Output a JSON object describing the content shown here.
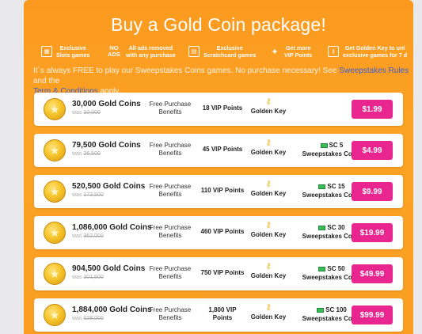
{
  "title": "Buy a Gold Coin package!",
  "features": [
    {
      "icon": "slots-icon",
      "glyph": "▦",
      "text1": "Exclusive",
      "text2": "Slots games"
    },
    {
      "icon": "no-ads-icon",
      "glyph": "NO ADS",
      "text1": "All ads removed",
      "text2": "with any purchase"
    },
    {
      "icon": "scratchcard-icon",
      "glyph": "▤",
      "text1": "Exclusive",
      "text2": "Scratchcard games"
    },
    {
      "icon": "sparkle-icon",
      "glyph": "✦",
      "text1": "Get more",
      "text2": "VIP Points"
    },
    {
      "icon": "key-icon",
      "glyph": "⚷",
      "text1": "Get Golden Key to unl",
      "text2": "exclusive games for 7 d"
    }
  ],
  "free_line": {
    "prefix": "It´s always FREE to play our Sweepstakes Coins games. No purchase necessary! See ",
    "link1": "Sweepstakes Rules",
    "middle": " and the",
    "link2": "Term & Conditions",
    "suffix": " apply."
  },
  "packages": [
    {
      "coins": "30,000 Gold Coins",
      "was_label": "was",
      "was": "10,000",
      "fpb1": "Free Purchase",
      "fpb2": "Benefits",
      "vip1": "18 VIP Points",
      "vip2": "",
      "gk": "Golden Key",
      "sc1": "",
      "sc2": "",
      "price": "$1.99"
    },
    {
      "coins": "79,500 Gold Coins",
      "was_label": "was",
      "was": "26,500",
      "fpb1": "Free Purchase",
      "fpb2": "Benefits",
      "vip1": "45 VIP Points",
      "vip2": "",
      "gk": "Golden Key",
      "sc1": "SC 5",
      "sc2": "Sweepstakes Coins",
      "price": "$4.99"
    },
    {
      "coins": "520,500 Gold Coins",
      "was_label": "was",
      "was": "173,500",
      "fpb1": "Free Purchase",
      "fpb2": "Benefits",
      "vip1": "110 VIP Points",
      "vip2": "",
      "gk": "Golden Key",
      "sc1": "SC 15",
      "sc2": "Sweepstakes Coins",
      "price": "$9.99"
    },
    {
      "coins": "1,086,000 Gold Coins",
      "was_label": "was",
      "was": "362,000",
      "fpb1": "Free Purchase",
      "fpb2": "Benefits",
      "vip1": "460 VIP Points",
      "vip2": "",
      "gk": "Golden Key",
      "sc1": "SC 30",
      "sc2": "Sweepstakes Coins",
      "price": "$19.99"
    },
    {
      "coins": "904,500 Gold Coins",
      "was_label": "was",
      "was": "301,500",
      "fpb1": "Free Purchase",
      "fpb2": "Benefits",
      "vip1": "750 VIP Points",
      "vip2": "",
      "gk": "Golden Key",
      "sc1": "SC 50",
      "sc2": "Sweepstakes Coins",
      "price": "$49.99"
    },
    {
      "coins": "1,884,000 Gold Coins",
      "was_label": "was",
      "was": "628,000",
      "fpb1": "Free Purchase",
      "fpb2": "Benefits",
      "vip1": "1,800 VIP",
      "vip2": "Points",
      "gk": "Golden Key",
      "sc1": "SC 100",
      "sc2": "Sweepstakes Coins",
      "price": "$99.99"
    }
  ],
  "colors": {
    "background": "#fb9e22",
    "buy_button": "#e9258f",
    "link": "#3c5fd1"
  }
}
